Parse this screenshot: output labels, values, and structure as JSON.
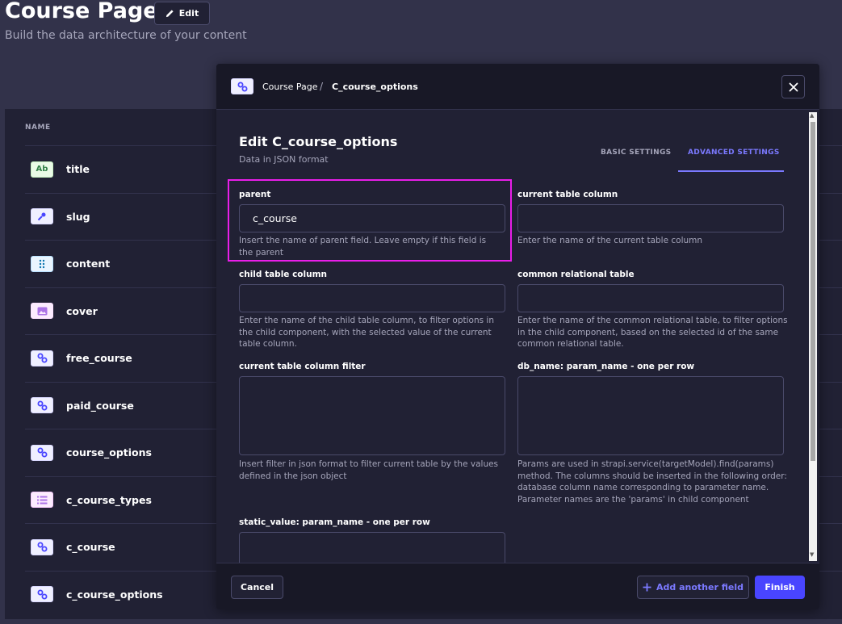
{
  "header": {
    "title": "Course Page",
    "edit_label": "Edit",
    "subtitle": "Build the data architecture of your content"
  },
  "list": {
    "column_header": "NAME",
    "rows": [
      {
        "label": "title",
        "icon": "text-icon",
        "badge": "Ab"
      },
      {
        "label": "slug",
        "icon": "key-icon"
      },
      {
        "label": "content",
        "icon": "dynamic-zone-icon"
      },
      {
        "label": "cover",
        "icon": "media-icon"
      },
      {
        "label": "free_course",
        "icon": "relation-icon"
      },
      {
        "label": "paid_course",
        "icon": "relation-icon"
      },
      {
        "label": "course_options",
        "icon": "relation-icon"
      },
      {
        "label": "c_course_types",
        "icon": "enumeration-icon"
      },
      {
        "label": "c_course",
        "icon": "relation-icon"
      },
      {
        "label": "c_course_options",
        "icon": "relation-icon"
      }
    ]
  },
  "modal": {
    "breadcrumb": [
      "Course Page",
      "C_course_options"
    ],
    "breadcrumb_separator": "/",
    "title": "Edit C_course_options",
    "subtitle": "Data in JSON format",
    "tabs": [
      {
        "label": "BASIC SETTINGS",
        "active": false
      },
      {
        "label": "ADVANCED SETTINGS",
        "active": true
      }
    ],
    "fields": {
      "parent": {
        "label": "parent",
        "value": "c_course",
        "hint": "Insert the name of parent field. Leave empty if this field is the parent"
      },
      "current_table_column": {
        "label": "current table column",
        "value": "",
        "hint": "Enter the name of the current table column"
      },
      "child_table_column": {
        "label": "child table column",
        "value": "",
        "hint": "Enter the name of the child table column, to filter options in the child component, with the selected value of the current table column."
      },
      "common_relational_table": {
        "label": "common relational table",
        "value": "",
        "hint": "Enter the name of the common relational table, to filter options in the child component, based on the selected id of the same common relational table."
      },
      "current_table_column_filter": {
        "label": "current table column filter",
        "value": "",
        "hint": "Insert filter in json format to filter current table by the values defined in the json object"
      },
      "db_name": {
        "label": "db_name: param_name - one per row",
        "value": "",
        "hint": "Params are used in strapi.service(targetModel).find(params) method. The columns should be inserted in the following order: database column name corresponding to parameter name. Parameter names are the 'params' in child component"
      },
      "static_value": {
        "label": "static_value: param_name - one per row",
        "value": ""
      }
    },
    "footer": {
      "cancel_label": "Cancel",
      "add_label": "Add another field",
      "finish_label": "Finish"
    }
  },
  "colors": {
    "accent": "#4945ff",
    "accent_text": "#7b79ff",
    "highlight": "#e91ee9",
    "background": "#32324a",
    "panel": "#212134"
  }
}
